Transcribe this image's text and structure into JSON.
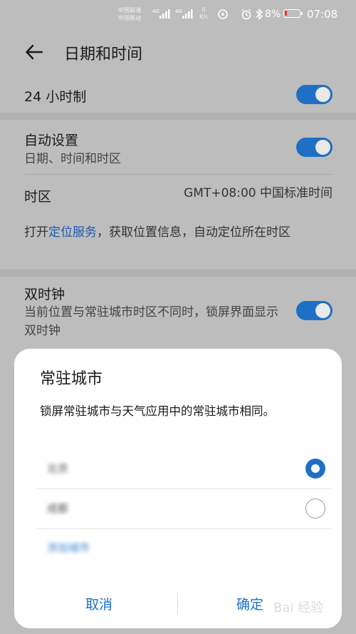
{
  "status_bar": {
    "carrier1": "中国联通",
    "carrier2": "中国移动",
    "net_speed_value": "0",
    "net_speed_unit": "K/s",
    "battery": "8%",
    "time": "07:08"
  },
  "header": {
    "title": "日期和时间"
  },
  "settings": {
    "hour24": {
      "label": "24 小时制",
      "enabled": true
    },
    "auto": {
      "label": "自动设置",
      "sub": "日期、时间和时区",
      "enabled": true
    },
    "timezone": {
      "label": "时区",
      "value": "GMT+08:00 中国标准时间"
    },
    "location_hint": {
      "pre": "打开",
      "link": "定位服务",
      "post": "，获取位置信息，自动定位所在时区"
    },
    "dual_clock": {
      "label": "双时钟",
      "sub": "当前位置与常驻城市时区不同时，锁屏界面显示双时钟",
      "enabled": true
    }
  },
  "dialog": {
    "title": "常驻城市",
    "body": "锁屏常驻城市与天气应用中的常驻城市相同。",
    "options": [
      {
        "label": "北京",
        "selected": true
      },
      {
        "label": "成都",
        "selected": false
      }
    ],
    "add_city": "添加城市",
    "cancel": "取消",
    "confirm": "确定"
  },
  "colors": {
    "accent": "#1e6fc5",
    "overlay_bg": "#bdbdbd"
  },
  "watermark": "Bai 经验"
}
